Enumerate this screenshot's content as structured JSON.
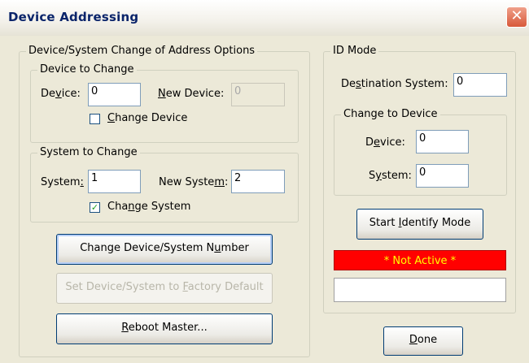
{
  "window": {
    "title": "Device Addressing",
    "close": "✕"
  },
  "left_group": {
    "legend": "Device/System Change of Address Options",
    "device_to_change": {
      "legend": "Device to Change",
      "device_label_pre": "De",
      "device_label_u": "v",
      "device_label_post": "ice:",
      "device_value": "0",
      "new_device_label_u": "N",
      "new_device_label_post": "ew Device:",
      "new_device_value": "0",
      "checkbox_label_u": "C",
      "checkbox_label_post": "hange Device",
      "checked": false
    },
    "system_to_change": {
      "legend": "System to Change",
      "system_label_pre": "System",
      "system_label_u": ":",
      "system_value": "1",
      "new_system_label_pre": "New Syste",
      "new_system_label_u": "m",
      "new_system_label_post": ":",
      "new_system_value": "2",
      "checkbox_label_pre": "Cha",
      "checkbox_label_u": "n",
      "checkbox_label_post": "ge System",
      "checked": true,
      "check_mark": "✓"
    },
    "buttons": {
      "change_number_pre": "Change Device/System N",
      "change_number_u": "u",
      "change_number_post": "mber",
      "factory_pre": "Set Device/System to ",
      "factory_u": "F",
      "factory_post": "actory Default",
      "reboot_pre": "",
      "reboot_u": "R",
      "reboot_post": "eboot Master..."
    }
  },
  "id_mode": {
    "legend": "ID Mode",
    "dest_label_pre": "De",
    "dest_label_u": "s",
    "dest_label_post": "tination System:",
    "dest_value": "0",
    "change_to_device": {
      "legend": "Change to Device",
      "device_label_pre": "D",
      "device_label_u": "e",
      "device_label_post": "vice:",
      "device_value": "0",
      "system_label_pre": "S",
      "system_label_u": "y",
      "system_label_post": "stem:",
      "system_value": "0"
    },
    "start_pre": "Start ",
    "start_u": "I",
    "start_post": "dentify Mode",
    "status": "* Not Active *",
    "status_box": ""
  },
  "done_u": "D",
  "done_post": "one",
  "colors": {
    "status_bg": "#ff0000",
    "status_text": "#ffff00",
    "title_text": "#0a246a"
  }
}
